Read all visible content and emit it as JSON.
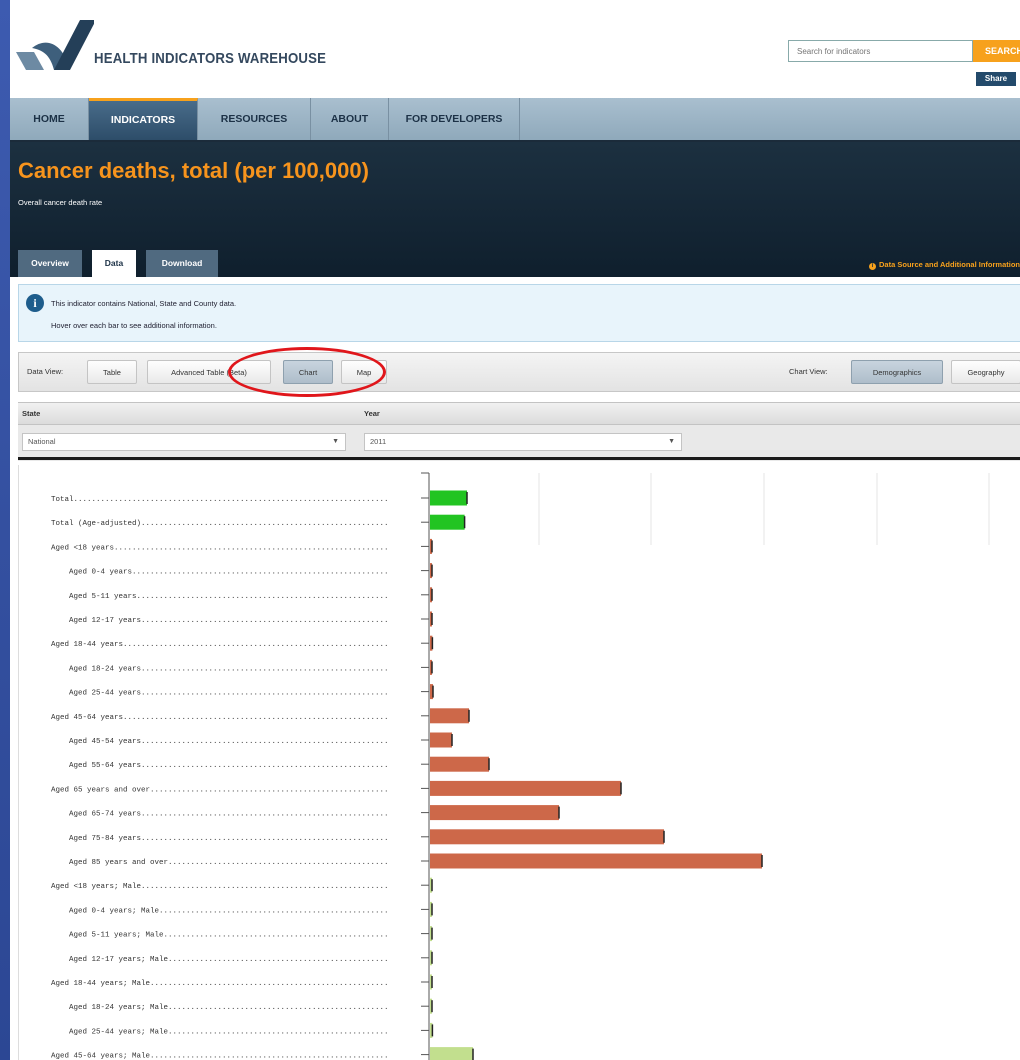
{
  "header": {
    "site_title": "HEALTH INDICATORS WAREHOUSE",
    "search_placeholder": "Search for indicators",
    "search_button": "SEARCH",
    "share_button": "Share"
  },
  "nav": {
    "items": [
      {
        "label": "HOME",
        "active": false
      },
      {
        "label": "INDICATORS",
        "active": true
      },
      {
        "label": "RESOURCES",
        "active": false
      },
      {
        "label": "ABOUT",
        "active": false
      },
      {
        "label": "FOR DEVELOPERS",
        "active": false
      }
    ]
  },
  "banner": {
    "title": "Cancer deaths, total (per 100,000)",
    "subtitle": "Overall cancer death rate",
    "tabs": [
      {
        "label": "Overview",
        "active": false
      },
      {
        "label": "Data",
        "active": true
      },
      {
        "label": "Download",
        "active": false
      }
    ],
    "data_source_link": "Data Source and Additional Information"
  },
  "info": {
    "line1": "This indicator contains National, State and County data.",
    "line2": "Hover over each bar to see additional information."
  },
  "data_view": {
    "label": "Data View:",
    "buttons": [
      {
        "label": "Table",
        "active": false
      },
      {
        "label": "Advanced Table (Beta)",
        "active": false
      },
      {
        "label": "Chart",
        "active": true
      },
      {
        "label": "Map",
        "active": false
      }
    ],
    "chart_view_label": "Chart View:",
    "chart_view_buttons": [
      {
        "label": "Demographics",
        "active": true
      },
      {
        "label": "Geography",
        "active": false
      }
    ],
    "highlight_color": "#e0161b"
  },
  "filters": {
    "state_label": "State",
    "state_value": "National",
    "year_label": "Year",
    "year_value": "2011"
  },
  "colors": {
    "total": "#22c422",
    "age": "#cd6849",
    "male": "#c2df8e",
    "accent": "#f7a11c",
    "title": "#f7941d"
  },
  "chart_data": {
    "type": "bar",
    "orientation": "horizontal",
    "xlim": [
      0,
      500
    ],
    "categories": [
      {
        "label": "Total",
        "indent": 0,
        "group": "total",
        "value": 185
      },
      {
        "label": "Total (Age-adjusted)",
        "indent": 0,
        "group": "total",
        "value": 173
      },
      {
        "label": "Aged <18 years",
        "indent": 0,
        "group": "age",
        "value": 2
      },
      {
        "label": "Aged 0-4 years",
        "indent": 1,
        "group": "age",
        "value": 2
      },
      {
        "label": "Aged 5-11 years",
        "indent": 1,
        "group": "age",
        "value": 2
      },
      {
        "label": "Aged 12-17 years",
        "indent": 1,
        "group": "age",
        "value": 2
      },
      {
        "label": "Aged 18-44 years",
        "indent": 0,
        "group": "age",
        "value": 12
      },
      {
        "label": "Aged 18-24 years",
        "indent": 1,
        "group": "age",
        "value": 4
      },
      {
        "label": "Aged 25-44 years",
        "indent": 1,
        "group": "age",
        "value": 15
      },
      {
        "label": "Aged 45-64 years",
        "indent": 0,
        "group": "age",
        "value": 195
      },
      {
        "label": "Aged 45-54 years",
        "indent": 1,
        "group": "age",
        "value": 110
      },
      {
        "label": "Aged 55-64 years",
        "indent": 1,
        "group": "age",
        "value": 295
      },
      {
        "label": "Aged 65 years and over",
        "indent": 0,
        "group": "age",
        "value": 955
      },
      {
        "label": "Aged 65-74 years",
        "indent": 1,
        "group": "age",
        "value": 645
      },
      {
        "label": "Aged 75-84 years",
        "indent": 1,
        "group": "age",
        "value": 1170
      },
      {
        "label": "Aged 85 years and over",
        "indent": 1,
        "group": "age",
        "value": 1660
      },
      {
        "label": "Aged <18 years; Male",
        "indent": 0,
        "group": "male",
        "value": 2
      },
      {
        "label": "Aged 0-4 years; Male",
        "indent": 1,
        "group": "male",
        "value": 2
      },
      {
        "label": "Aged 5-11 years; Male",
        "indent": 1,
        "group": "male",
        "value": 2
      },
      {
        "label": "Aged 12-17 years; Male",
        "indent": 1,
        "group": "male",
        "value": 2
      },
      {
        "label": "Aged 18-44 years; Male",
        "indent": 0,
        "group": "male",
        "value": 10
      },
      {
        "label": "Aged 18-24 years; Male",
        "indent": 1,
        "group": "male",
        "value": 4
      },
      {
        "label": "Aged 25-44 years; Male",
        "indent": 1,
        "group": "male",
        "value": 12
      },
      {
        "label": "Aged 45-64 years; Male",
        "indent": 0,
        "group": "male",
        "value": 215
      }
    ]
  }
}
